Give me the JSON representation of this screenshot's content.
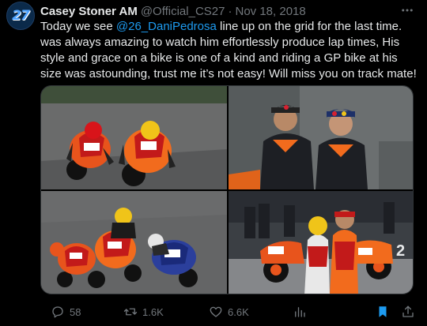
{
  "tweet": {
    "author": {
      "name": "Casey Stoner AM",
      "handle": "@Official_CS27",
      "avatar_text": "27"
    },
    "separator": "·",
    "date": "Nov 18, 2018",
    "text_before": "Today we see ",
    "mention": "@26_DaniPedrosa",
    "text_after": " line up on the grid for the last time. was always amazing to watch him effortlessly produce lap times, His style and grace on a bike is one of a kind and riding a GP bike at his size was astounding, trust me it’s not easy! Will miss you on track mate!",
    "media": [
      {
        "icon": "photo-two-riders-racing"
      },
      {
        "icon": "photo-two-riders-portrait"
      },
      {
        "icon": "photo-three-riders-racing"
      },
      {
        "icon": "photo-riders-pit-lane"
      }
    ],
    "actions": {
      "replies": "58",
      "retweets": "1.6K",
      "likes": "6.6K"
    }
  },
  "colors": {
    "background": "#000000",
    "text": "#e7e9ea",
    "muted": "#71767b",
    "link": "#1d9bf0",
    "bookmark_active": "#1d9bf0"
  }
}
